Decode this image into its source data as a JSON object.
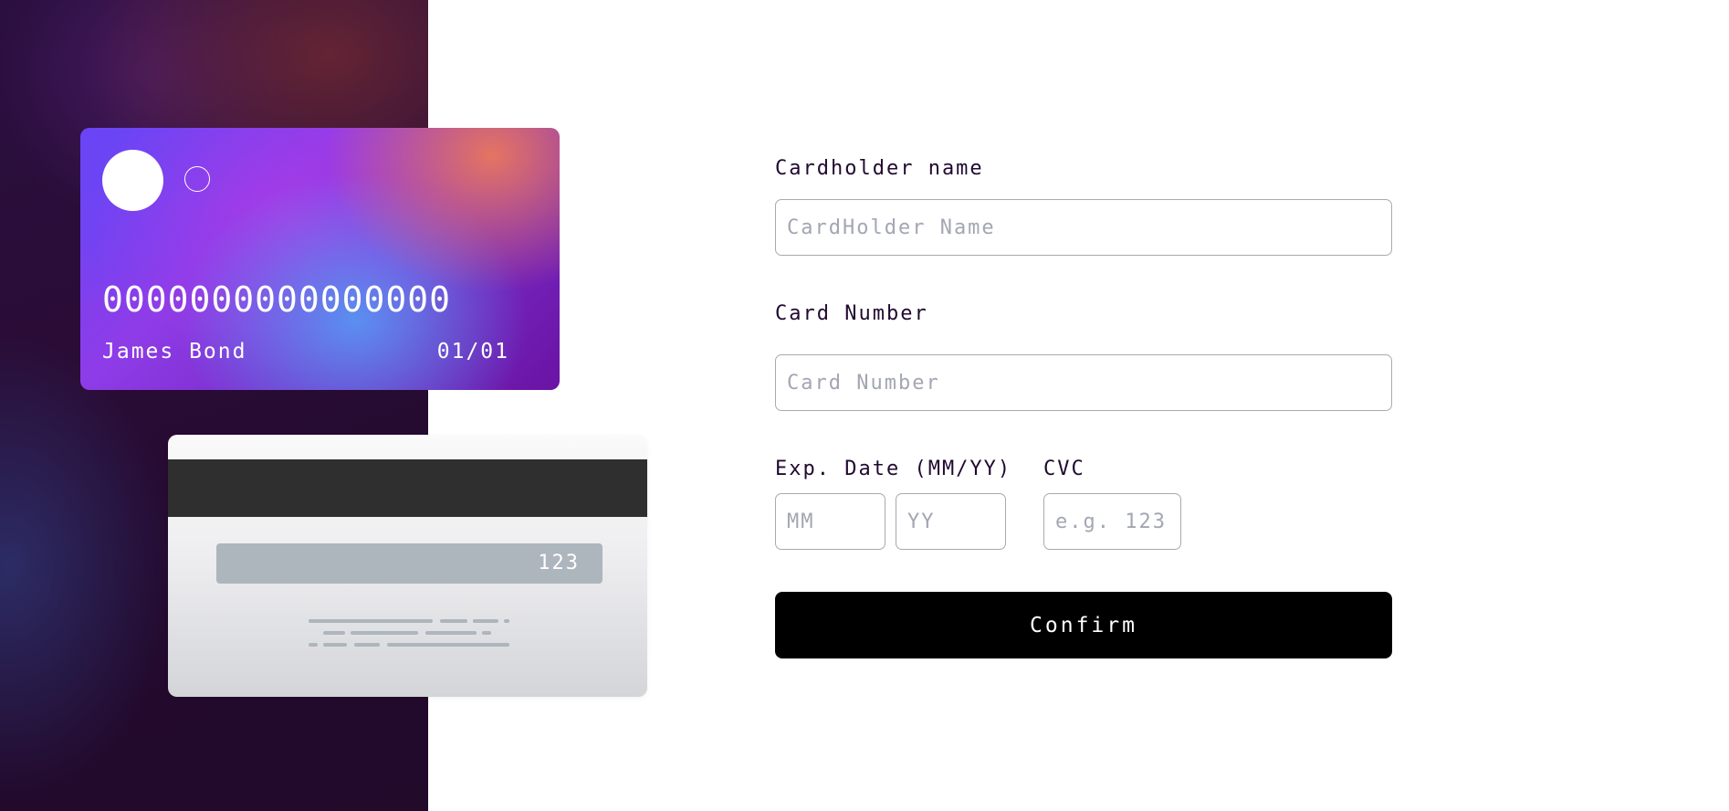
{
  "card_front": {
    "number": "0000000000000000",
    "name": "James Bond",
    "expiry": "01/01"
  },
  "card_back": {
    "cvc": "123"
  },
  "form": {
    "cardholder_label": "Cardholder name",
    "cardholder_placeholder": "CardHolder Name",
    "cardholder_value": "",
    "number_label": "Card Number",
    "number_placeholder": "Card Number",
    "number_value": "",
    "expiry_label": "Exp. Date (MM/YY)",
    "month_placeholder": "MM",
    "year_placeholder": "YY",
    "cvc_label": "CVC",
    "cvc_placeholder": "e.g. 123",
    "confirm_label": "Confirm"
  },
  "colors": {
    "button_bg": "#000000",
    "input_border": "#a9a9b0",
    "placeholder": "#a3a6b3",
    "label_text": "#21092f"
  }
}
